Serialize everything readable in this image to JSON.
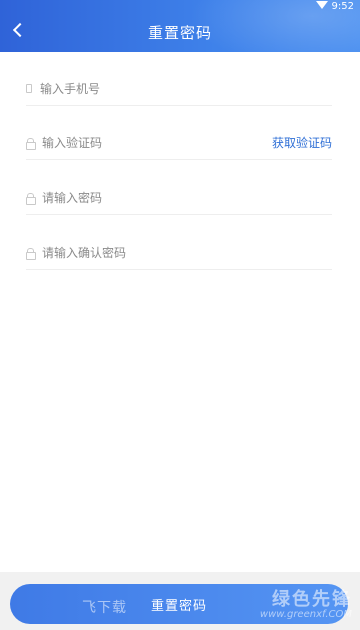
{
  "status_bar": {
    "time": "9:52"
  },
  "header": {
    "title": "重置密码",
    "back_icon": "chevron-left-icon"
  },
  "form": {
    "phone": {
      "placeholder": "输入手机号",
      "value": "",
      "icon": "phone-icon"
    },
    "code": {
      "placeholder": "输入验证码",
      "value": "",
      "icon": "lock-icon",
      "get_code_label": "获取验证码"
    },
    "password": {
      "placeholder": "请输入密码",
      "value": "",
      "icon": "lock-icon"
    },
    "confirm_password": {
      "placeholder": "请输入确认密码",
      "value": "",
      "icon": "lock-icon"
    }
  },
  "submit": {
    "label": "重置密码"
  },
  "watermark": {
    "left": "飞下载",
    "right_big": "绿色先锋",
    "right_small": "www.greenxf.COM"
  },
  "colors": {
    "header_gradient_start": "#2f63d8",
    "header_gradient_end": "#4a8ff0",
    "accent_link": "#2f6fd6",
    "button": "#4a86ec"
  }
}
